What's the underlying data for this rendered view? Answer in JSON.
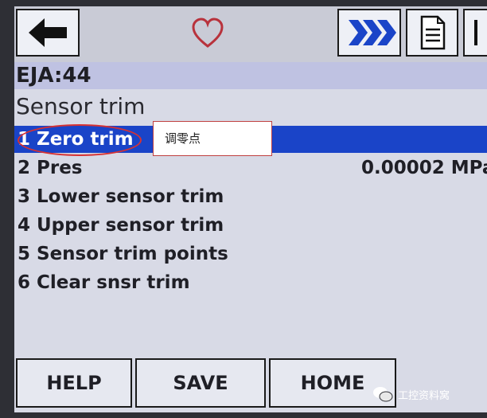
{
  "toolbar": {
    "icons": [
      "back-arrow-icon",
      "heart-icon",
      "forward-chevrons-icon",
      "document-icon",
      "page-end-icon"
    ],
    "accent_color": "#1a44c8"
  },
  "header": {
    "device_tag": "EJA:44",
    "menu_title": "Sensor trim"
  },
  "menu": {
    "items": [
      {
        "label": "1 Zero trim",
        "value": ""
      },
      {
        "label": "2 Pres",
        "value": "0.00002 MPa"
      },
      {
        "label": "3 Lower sensor trim",
        "value": ""
      },
      {
        "label": "4 Upper sensor trim",
        "value": ""
      },
      {
        "label": "5 Sensor trim points",
        "value": ""
      },
      {
        "label": "6 Clear snsr trim",
        "value": ""
      }
    ],
    "selected_index": 0
  },
  "annotation": {
    "callout_text": "调零点",
    "highlight_color": "#d83232"
  },
  "softkeys": {
    "help": "HELP",
    "save": "SAVE",
    "home": "HOME"
  },
  "watermark": {
    "text": "工控资料窝"
  }
}
